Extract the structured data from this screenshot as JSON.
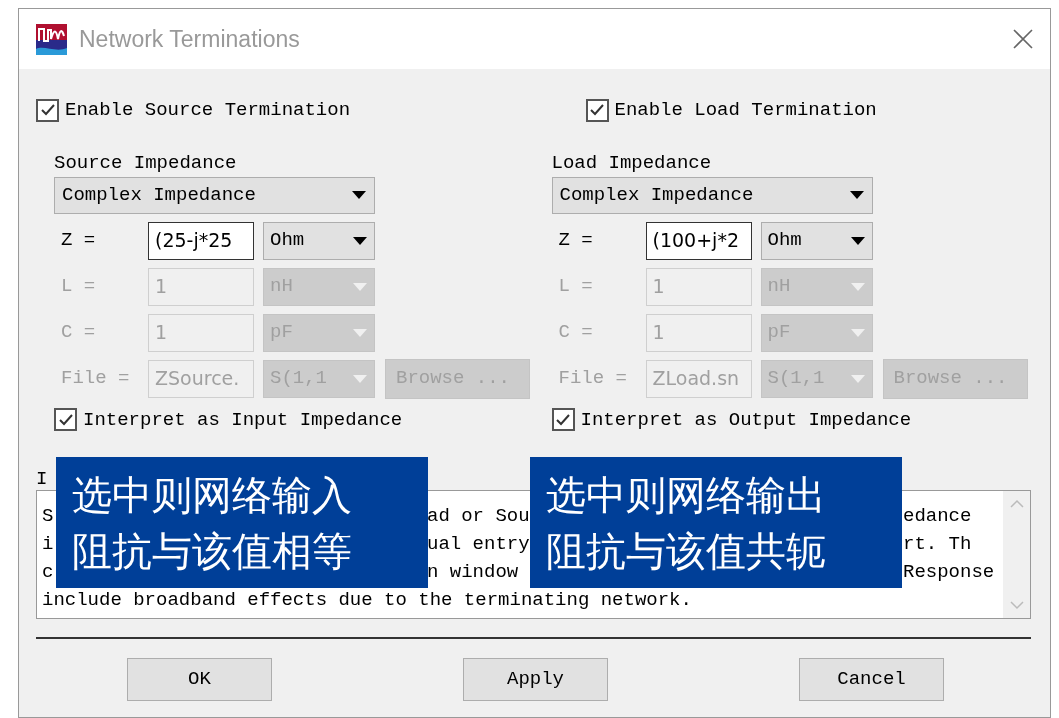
{
  "window": {
    "title": "Network Terminations"
  },
  "panels": [
    {
      "enable": {
        "label": "Enable Source Termination",
        "checked": true
      },
      "heading": "Source Impedance",
      "type_select": "Complex Impedance",
      "rows": [
        {
          "label": "Z =",
          "value": "(25-j*25",
          "unit": "Ohm",
          "disabled": false
        },
        {
          "label": "L =",
          "value": "1",
          "unit": "nH",
          "disabled": true
        },
        {
          "label": "C =",
          "value": "1",
          "unit": "pF",
          "disabled": true
        },
        {
          "label": "File =",
          "value": "ZSource.",
          "unit": "S(1,1",
          "disabled": true,
          "browse": {
            "label": "Browse ...",
            "disabled": true
          }
        }
      ],
      "interpret": {
        "label": "Interpret as Input Impedance",
        "checked": true
      }
    },
    {
      "enable": {
        "label": "Enable Load Termination",
        "checked": true
      },
      "heading": "Load Impedance",
      "type_select": "Complex Impedance",
      "rows": [
        {
          "label": "Z =",
          "value": "(100+j*2",
          "unit": "Ohm",
          "disabled": false
        },
        {
          "label": "L =",
          "value": "1",
          "unit": "nH",
          "disabled": true
        },
        {
          "label": "C =",
          "value": "1",
          "unit": "pF",
          "disabled": true
        },
        {
          "label": "File =",
          "value": "ZLoad.sn",
          "unit": "S(1,1",
          "disabled": true,
          "browse": {
            "label": "Browse ...",
            "disabled": true
          }
        }
      ],
      "interpret": {
        "label": "Interpret as Output Impedance",
        "checked": true
      }
    }
  ],
  "info": {
    "label": "I",
    "lines": [
      [
        "S",
        "ad or Sou",
        "edance"
      ],
      [
        "i",
        "ual entry",
        "rt.  Th"
      ],
      [
        "c",
        "n window",
        "Response"
      ],
      [
        "include broadband effects due to the terminating network."
      ]
    ]
  },
  "annotations": [
    {
      "lines": [
        "选中则网络输入",
        "阻抗与该值相等"
      ]
    },
    {
      "lines": [
        "选中则网络输出",
        "阻抗与该值共轭"
      ]
    }
  ],
  "buttons": [
    {
      "label": "OK"
    },
    {
      "label": "Apply"
    },
    {
      "label": "Cancel"
    }
  ]
}
